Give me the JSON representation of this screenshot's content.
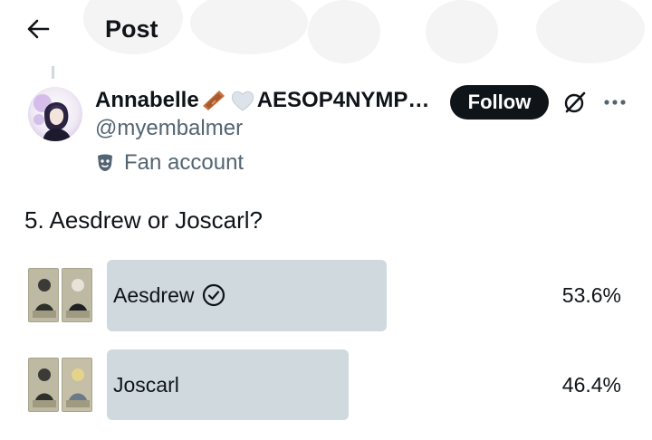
{
  "header": {
    "title": "Post",
    "back_icon": "arrow-left-icon"
  },
  "author": {
    "display_name": "Annabelle",
    "display_name_emoji_1": "coffin-icon",
    "display_name_emoji_2": "white-heart-icon",
    "display_name_suffix": "AESOP4NYMP…",
    "handle": "@myembalmer",
    "label": "Fan account",
    "label_icon": "performing-arts-mask-icon"
  },
  "actions": {
    "follow_label": "Follow",
    "grok_icon": "grok-icon",
    "more_icon": "more-horizontal-icon"
  },
  "post": {
    "text": "5. Aesdrew or Joscarl?"
  },
  "poll": {
    "options": [
      {
        "label": "Aesdrew",
        "percent": "53.6%",
        "fraction": 0.536,
        "selected": true,
        "selected_icon": "check-circle-icon"
      },
      {
        "label": "Joscarl",
        "percent": "46.4%",
        "fraction": 0.464,
        "selected": false
      }
    ]
  },
  "colors": {
    "text": "#0f1419",
    "secondary_text": "#536471",
    "poll_bar": "#cfd9de",
    "follow_bg": "#0f1419",
    "follow_text": "#ffffff"
  }
}
